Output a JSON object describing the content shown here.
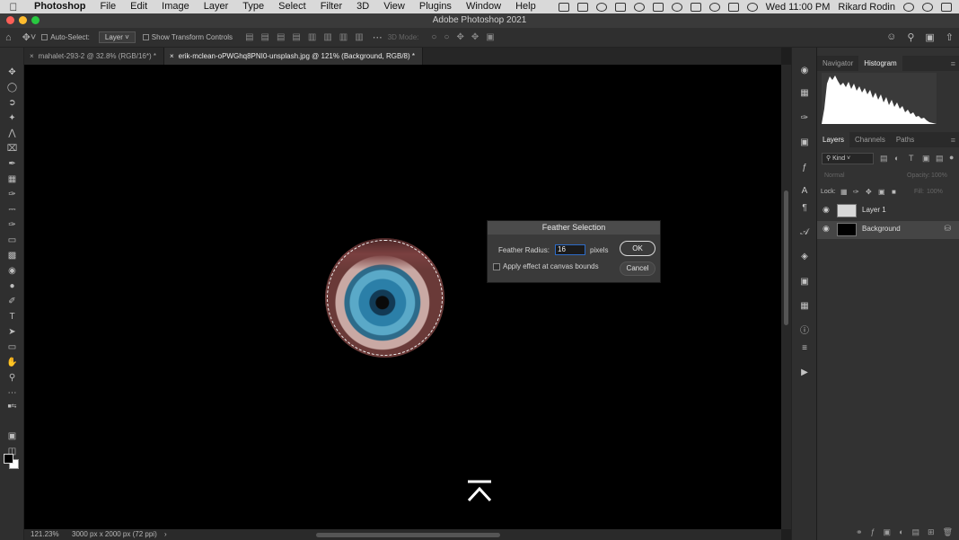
{
  "menubar": {
    "apple_icon": "apple-icon",
    "app": "Photoshop",
    "items": [
      "File",
      "Edit",
      "Image",
      "Layer",
      "Type",
      "Select",
      "Filter",
      "3D",
      "View",
      "Plugins",
      "Window",
      "Help"
    ],
    "clock": "Wed 11:00 PM",
    "user": "Rikard Rodin"
  },
  "window": {
    "title": "Adobe Photoshop 2021"
  },
  "options": {
    "auto_select_label": "Auto-Select:",
    "auto_select_value": "Layer",
    "transform_label": "Show Transform Controls",
    "mode_3d_label": "3D Mode:"
  },
  "tabs": [
    {
      "label": "mahalet-293-2 @ 32.8% (RGB/16*) *",
      "active": false
    },
    {
      "label": "erik-mclean-oPWGhq8PNI0-unsplash.jpg @ 121% (Background, RGB/8) *",
      "active": true
    }
  ],
  "status": {
    "zoom": "121.23%",
    "dimensions": "3000 px x 2000 px (72 ppi)",
    "arrow": "›"
  },
  "panels": {
    "top_tabs": [
      "Navigator",
      "Histogram"
    ],
    "layer_tabs": [
      "Layers",
      "Channels",
      "Paths"
    ],
    "kind": "Kind",
    "blend": "Normal",
    "opacity_label": "Opacity:",
    "opacity_value": "100%",
    "lock_label": "Lock:",
    "fill_label": "Fill:",
    "fill_value": "100%",
    "layers": [
      {
        "name": "Layer 1",
        "thumb": "#d8d8d8",
        "active": false,
        "locked": false
      },
      {
        "name": "Background",
        "thumb": "#000000",
        "active": true,
        "locked": true
      }
    ]
  },
  "dialog": {
    "title": "Feather Selection",
    "radius_label": "Feather Radius:",
    "radius_value": "16",
    "unit": "pixels",
    "checkbox_label": "Apply effect at canvas bounds",
    "ok": "OK",
    "cancel": "Cancel"
  },
  "colors": {
    "canvas": "#000000",
    "panel": "#323232",
    "accent": "#2e6cc7"
  }
}
